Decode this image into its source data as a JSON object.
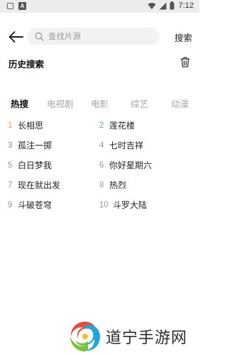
{
  "status_bar": {
    "time": "7:12",
    "left_icons": [
      "notification-square-icon",
      "app-a-icon"
    ],
    "right_icons": [
      "wifi-icon",
      "signal-icon",
      "battery-icon"
    ]
  },
  "header": {
    "search_placeholder": "查找片源",
    "search_button": "搜索"
  },
  "history": {
    "title": "历史搜索"
  },
  "tabs": [
    {
      "label": "热搜",
      "active": true
    },
    {
      "label": "电视剧",
      "active": false
    },
    {
      "label": "电影",
      "active": false
    },
    {
      "label": "综艺",
      "active": false
    },
    {
      "label": "动漫",
      "active": false
    }
  ],
  "hot_list": [
    {
      "rank": "1",
      "title": "长相思",
      "rank_color": "#f0a35a"
    },
    {
      "rank": "2",
      "title": "莲花楼",
      "rank_color": "#4cc36a"
    },
    {
      "rank": "3",
      "title": "孤注一掷",
      "rank_color": "#8c84d8"
    },
    {
      "rank": "4",
      "title": "七时吉祥",
      "rank_color": "#9a9a9a"
    },
    {
      "rank": "5",
      "title": "白日梦我",
      "rank_color": "#9a9a9a"
    },
    {
      "rank": "6",
      "title": "你好星期六",
      "rank_color": "#9a9a9a"
    },
    {
      "rank": "7",
      "title": "现在就出发",
      "rank_color": "#9a9a9a"
    },
    {
      "rank": "8",
      "title": "热烈",
      "rank_color": "#9a9a9a"
    },
    {
      "rank": "9",
      "title": "斗破苍穹",
      "rank_color": "#9a9a9a"
    },
    {
      "rank": "10",
      "title": "斗罗大陆",
      "rank_color": "#9a9a9a"
    }
  ],
  "watermark": {
    "text": "道宁手游网"
  },
  "colors": {
    "tab_inactive": "#a6a6a6",
    "search_bg": "#f2f2f2",
    "statusbar_bg": "#ececec"
  }
}
